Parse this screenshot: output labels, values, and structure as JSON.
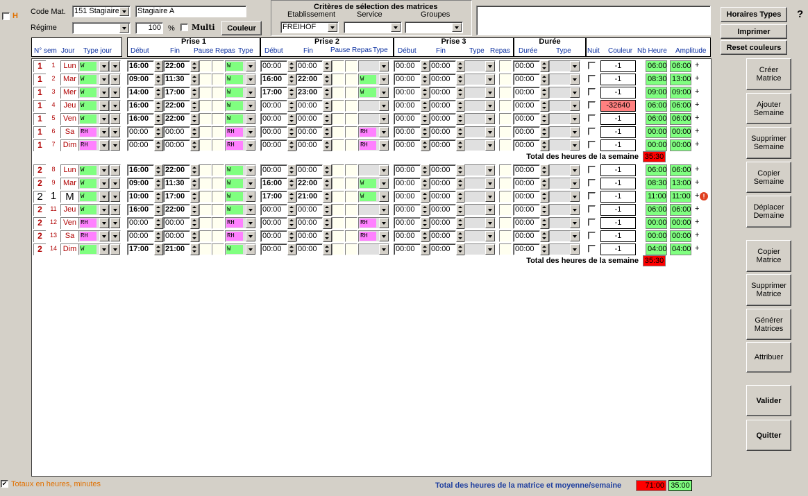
{
  "top": {
    "h_checkbox_label": "H",
    "code_mat_label": "Code Mat.",
    "code_mat_value": "151 Stagiaire A",
    "name_value": "Stagiaire A",
    "regime_label": "Régime",
    "regime_value": "",
    "percent_value": "100",
    "percent_sign": "%",
    "multi_label": "Multi",
    "couleur_button": "Couleur",
    "criteria_title": "Critères de sélection des matrices",
    "etab_label": "Etablissement",
    "service_label": "Service",
    "groupes_label": "Groupes",
    "etab_value": "FREIHOF",
    "service_value": "",
    "groupes_value": ""
  },
  "right_top": {
    "horaires_types": "Horaires Types",
    "imprimer": "Imprimer",
    "reset_couleurs": "Reset couleurs",
    "help": "?"
  },
  "headers": {
    "nsem": "N° sem",
    "jour": "Jour",
    "type_jour": "Type jour",
    "prise1": "Prise 1",
    "prise2": "Prise 2",
    "prise3": "Prise 3",
    "duree": "Durée",
    "debut": "Début",
    "fin": "Fin",
    "pause": "Pause",
    "repas": "Repas",
    "type": "Type",
    "duree_sub": "Durée",
    "nuit": "Nuit",
    "couleur": "Couleur",
    "nb_heure": "Nb Heure",
    "amplitude": "Amplitude"
  },
  "week1": [
    {
      "sem": "1",
      "n": "1",
      "jour": "Lun",
      "tj": "W",
      "p1d": "16:00",
      "p1f": "22:00",
      "p1t": "W",
      "p2d": "00:00",
      "p2f": "00:00",
      "p2t": "",
      "coul": "-1",
      "nb": "06:00",
      "amp": "06:00"
    },
    {
      "sem": "1",
      "n": "2",
      "jour": "Mar",
      "tj": "W",
      "p1d": "09:00",
      "p1f": "11:30",
      "p1t": "W",
      "p2d": "16:00",
      "p2f": "22:00",
      "p2t": "W",
      "coul": "-1",
      "nb": "08:30",
      "amp": "13:00"
    },
    {
      "sem": "1",
      "n": "3",
      "jour": "Mer",
      "tj": "W",
      "p1d": "14:00",
      "p1f": "17:00",
      "p1t": "W",
      "p2d": "17:00",
      "p2f": "23:00",
      "p2t": "W",
      "coul": "-1",
      "nb": "09:00",
      "amp": "09:00"
    },
    {
      "sem": "1",
      "n": "4",
      "jour": "Jeu",
      "tj": "W",
      "p1d": "16:00",
      "p1f": "22:00",
      "p1t": "W",
      "p2d": "00:00",
      "p2f": "00:00",
      "p2t": "",
      "coul": "-32640",
      "nb": "06:00",
      "amp": "06:00"
    },
    {
      "sem": "1",
      "n": "5",
      "jour": "Ven",
      "tj": "W",
      "p1d": "16:00",
      "p1f": "22:00",
      "p1t": "W",
      "p2d": "00:00",
      "p2f": "00:00",
      "p2t": "",
      "coul": "-1",
      "nb": "06:00",
      "amp": "06:00"
    },
    {
      "sem": "1",
      "n": "6",
      "jour": "Sa",
      "tj": "RH",
      "p1d": "00:00",
      "p1f": "00:00",
      "p1t": "RH",
      "p2d": "00:00",
      "p2f": "00:00",
      "p2t": "RH",
      "coul": "-1",
      "nb": "00:00",
      "amp": "00:00"
    },
    {
      "sem": "1",
      "n": "7",
      "jour": "Dim",
      "tj": "RH",
      "p1d": "00:00",
      "p1f": "00:00",
      "p1t": "RH",
      "p2d": "00:00",
      "p2f": "00:00",
      "p2t": "RH",
      "coul": "-1",
      "nb": "00:00",
      "amp": "00:00"
    }
  ],
  "week2": [
    {
      "sem": "2",
      "n": "8",
      "jour": "Lun",
      "tj": "W",
      "p1d": "16:00",
      "p1f": "22:00",
      "p1t": "W",
      "p2d": "00:00",
      "p2f": "00:00",
      "p2t": "",
      "coul": "-1",
      "nb": "06:00",
      "amp": "06:00"
    },
    {
      "sem": "2",
      "n": "9",
      "jour": "Mar",
      "tj": "W",
      "p1d": "09:00",
      "p1f": "11:30",
      "p1t": "W",
      "p2d": "16:00",
      "p2f": "22:00",
      "p2t": "W",
      "coul": "-1",
      "nb": "08:30",
      "amp": "13:00"
    },
    {
      "sem": "2",
      "n": "1",
      "jour": "M",
      "tj": "W",
      "p1d": "10:00",
      "p1f": "17:00",
      "p1t": "W",
      "p2d": "17:00",
      "p2f": "21:00",
      "p2t": "W",
      "coul": "-1",
      "nb": "11:00",
      "amp": "11:00",
      "big": true,
      "warn": true
    },
    {
      "sem": "2",
      "n": "11",
      "jour": "Jeu",
      "tj": "W",
      "p1d": "16:00",
      "p1f": "22:00",
      "p1t": "W",
      "p2d": "00:00",
      "p2f": "00:00",
      "p2t": "",
      "coul": "-1",
      "nb": "06:00",
      "amp": "06:00"
    },
    {
      "sem": "2",
      "n": "12",
      "jour": "Ven",
      "tj": "RH",
      "p1d": "00:00",
      "p1f": "00:00",
      "p1t": "RH",
      "p2d": "00:00",
      "p2f": "00:00",
      "p2t": "RH",
      "coul": "-1",
      "nb": "00:00",
      "amp": "00:00"
    },
    {
      "sem": "2",
      "n": "13",
      "jour": "Sa",
      "tj": "RH",
      "p1d": "00:00",
      "p1f": "00:00",
      "p1t": "RH",
      "p2d": "00:00",
      "p2f": "00:00",
      "p2t": "RH",
      "coul": "-1",
      "nb": "00:00",
      "amp": "00:00"
    },
    {
      "sem": "2",
      "n": "14",
      "jour": "Dim",
      "tj": "W",
      "p1d": "17:00",
      "p1f": "21:00",
      "p1t": "W",
      "p2d": "00:00",
      "p2f": "00:00",
      "p2t": "",
      "coul": "-1",
      "nb": "04:00",
      "amp": "04:00"
    }
  ],
  "p3_value": "00:00",
  "plus": "+",
  "total_week_label": "Total des heures de la semaine",
  "total_week1": "35:30",
  "total_week2": "35:30",
  "side_buttons": [
    "Créer Matrice",
    "Ajouter Semaine",
    "Supprimer Semaine",
    "Copier Semaine",
    "Déplacer Demaine",
    "Copier Matrice",
    "Supprimer Matrice",
    "Générer Matrices",
    "Attribuer"
  ],
  "valider": "Valider",
  "quitter": "Quitter",
  "bottom": {
    "totaux_label": "Totaux en heures, minutes",
    "total_matrice_label": "Total des heures de la matrice et moyenne/semaine",
    "total_matrice": "71:00",
    "moyenne": "35:00"
  },
  "colors": {
    "green": "#80ff80",
    "pink": "#ff80ff",
    "red": "#ff0000",
    "salmon": "#ff8080"
  }
}
